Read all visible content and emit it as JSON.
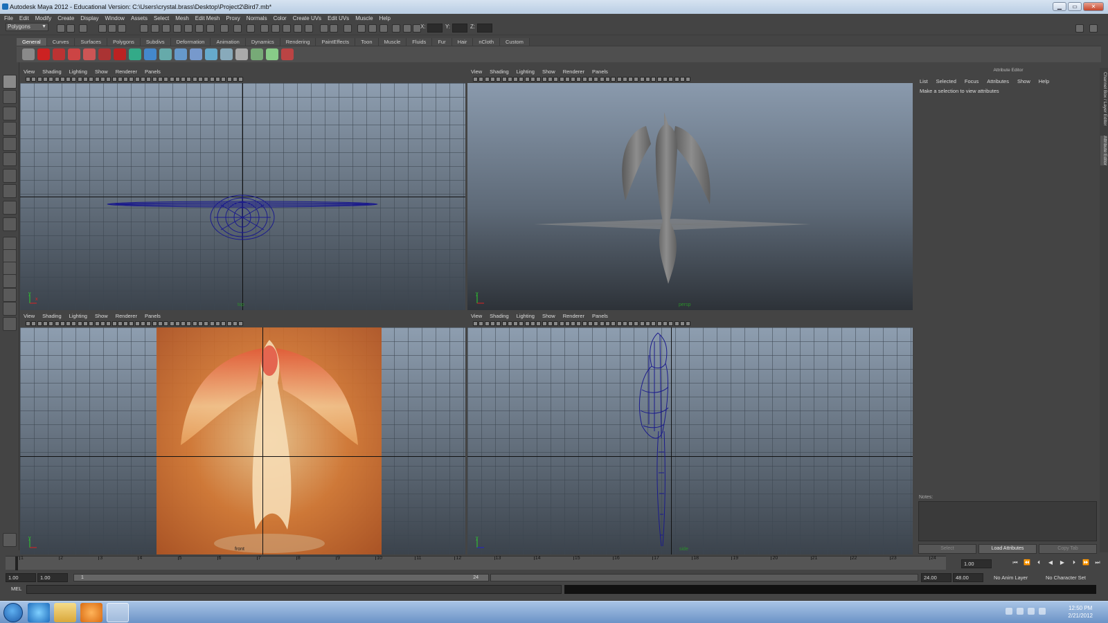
{
  "window": {
    "title": "Autodesk Maya 2012 - Educational Version: C:\\Users\\crystal.brass\\Desktop\\Project2\\Bird7.mb*",
    "min": "▁",
    "max": "▭",
    "close": "✕"
  },
  "menus": [
    "File",
    "Edit",
    "Modify",
    "Create",
    "Display",
    "Window",
    "Assets",
    "Select",
    "Mesh",
    "Edit Mesh",
    "Proxy",
    "Normals",
    "Color",
    "Create UVs",
    "Edit UVs",
    "Muscle",
    "Help"
  ],
  "status": {
    "mode": "Polygons",
    "x_label": "X:",
    "y_label": "Y:",
    "z_label": "Z:"
  },
  "shelf_tabs": [
    "General",
    "Curves",
    "Surfaces",
    "Polygons",
    "Subdivs",
    "Deformation",
    "Animation",
    "Dynamics",
    "Rendering",
    "PaintEffects",
    "Toon",
    "Muscle",
    "Fluids",
    "Fur",
    "Hair",
    "nCloth",
    "Custom"
  ],
  "panel_menu": [
    "View",
    "Shading",
    "Lighting",
    "Show",
    "Renderer",
    "Panels"
  ],
  "viewports": {
    "top_label": "top",
    "persp_label": "persp",
    "front_label": "front",
    "side_label": "side"
  },
  "attribute_editor": {
    "title": "Attribute Editor",
    "menu": [
      "List",
      "Selected",
      "Focus",
      "Attributes",
      "Show",
      "Help"
    ],
    "message": "Make a selection to view attributes",
    "notes_label": "Notes:",
    "btn_select": "Select",
    "btn_load": "Load Attributes",
    "btn_copy": "Copy Tab"
  },
  "side_tabs": {
    "channel": "Channel Box / Layer Editor",
    "attr": "Attribute Editor"
  },
  "timeline": {
    "ticks": [
      "1",
      "2",
      "3",
      "4",
      "5",
      "6",
      "7",
      "8",
      "9",
      "10",
      "11",
      "12",
      "13",
      "14",
      "15",
      "16",
      "17",
      "18",
      "19",
      "20",
      "21",
      "22",
      "23",
      "24"
    ],
    "current_frame": "1.00",
    "play": [
      "⏮",
      "⏪",
      "⏴",
      "◀",
      "▶",
      "⏵",
      "⏩",
      "⏭"
    ]
  },
  "range": {
    "start": "1.00",
    "start2": "1.00",
    "slider_start": "1",
    "slider_end": "24",
    "end": "24.00",
    "end2": "48.00",
    "anim_layer": "No Anim Layer",
    "char_set": "No Character Set"
  },
  "mel": {
    "label": "MEL"
  },
  "taskbar": {
    "time": "12:50 PM",
    "date": "2/21/2012"
  },
  "colors": {
    "wire": "#1a1a8c",
    "accent": "#e07a2a"
  }
}
